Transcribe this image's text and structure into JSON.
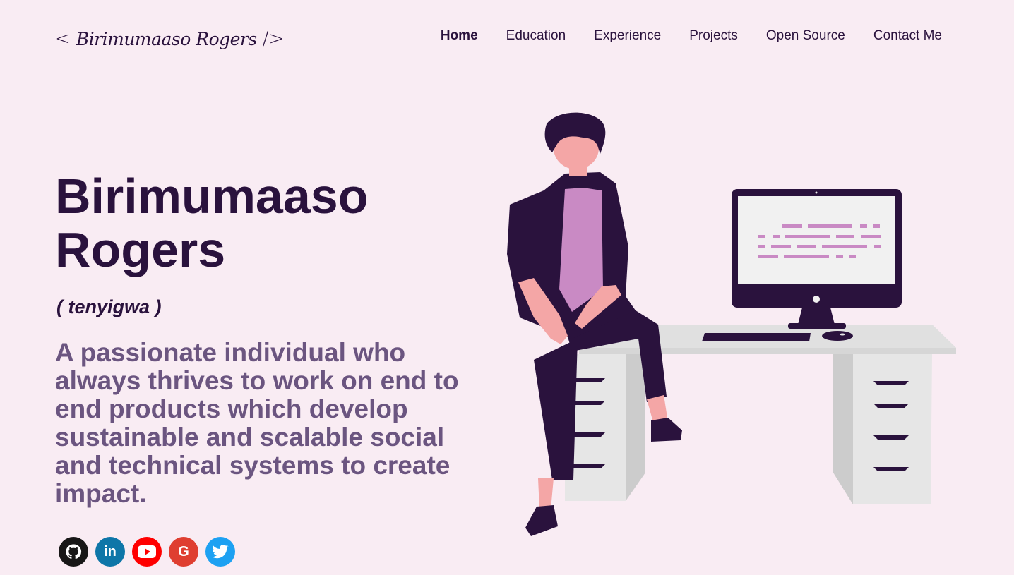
{
  "header": {
    "logo_open": "<",
    "logo_name": "Birimumaaso Rogers",
    "logo_close": "/>",
    "nav": [
      {
        "label": "Home",
        "active": true
      },
      {
        "label": "Education"
      },
      {
        "label": "Experience"
      },
      {
        "label": "Projects"
      },
      {
        "label": "Open Source"
      },
      {
        "label": "Contact Me"
      }
    ]
  },
  "hero": {
    "name_line1": "Birimumaaso",
    "name_line2": "Rogers",
    "nickname": "( tenyigwa )",
    "tagline": "A passionate individual who always thrives to work on end to end products which develop sustainable and scalable social and technical systems to create impact."
  },
  "socials": [
    {
      "icon": "github-icon",
      "color": "#181717",
      "glyph": ""
    },
    {
      "icon": "linkedin-icon",
      "color": "#0e76a8",
      "glyph": "in"
    },
    {
      "icon": "youtube-icon",
      "color": "#ff0000",
      "glyph": "▶"
    },
    {
      "icon": "google-icon",
      "color": "#df3e30",
      "glyph": "G"
    },
    {
      "icon": "twitter-icon",
      "color": "#1da1f2",
      "glyph": ""
    }
  ],
  "colors": {
    "background": "#f9ecf3",
    "heading": "#2a123d",
    "subtext": "#6b5580",
    "accent": "#c98ac4"
  }
}
